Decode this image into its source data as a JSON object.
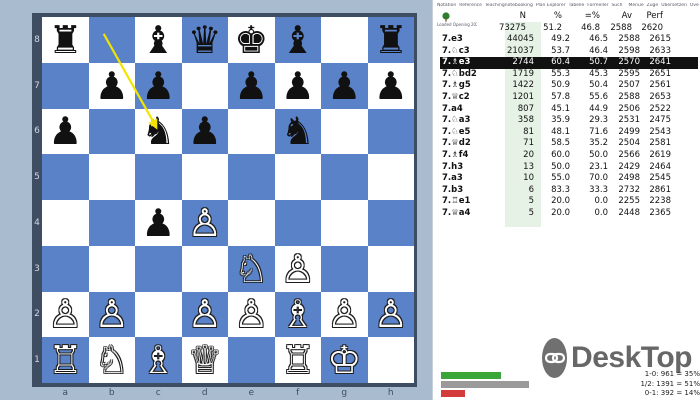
{
  "menu": [
    "Notation",
    "Reference",
    "Teachingnotebooking",
    "Plan Explorer",
    "Tabelle",
    "Formeller",
    "Such",
    "",
    "Menue",
    "Züge",
    "Übersetzen",
    "Overlaufi"
  ],
  "tree_caption": "Loaded Opening 2021",
  "board": {
    "ranks": [
      "8",
      "7",
      "6",
      "5",
      "4",
      "3",
      "2",
      "1"
    ],
    "files": [
      "a",
      "b",
      "c",
      "d",
      "e",
      "f",
      "g",
      "h"
    ],
    "squares": [
      [
        "♜",
        "",
        "♝",
        "♛",
        "♚",
        "♝",
        "",
        "♜"
      ],
      [
        "",
        "♟",
        "♟",
        "",
        "♟",
        "♟",
        "♟",
        "♟"
      ],
      [
        "♟",
        "",
        "♞",
        "♟",
        "",
        "♞",
        "",
        ""
      ],
      [
        "",
        "",
        "",
        "",
        "",
        "",
        "",
        ""
      ],
      [
        "",
        "",
        "♟",
        "♙",
        "",
        "",
        "",
        ""
      ],
      [
        "",
        "",
        "",
        "",
        "♘",
        "♙",
        "",
        ""
      ],
      [
        "♙",
        "♙",
        "",
        "♙",
        "♙",
        "♗",
        "♙",
        "♙"
      ],
      [
        "♖",
        "♘",
        "♗",
        "♕",
        "",
        "♖",
        "♔",
        ""
      ]
    ],
    "colors": [
      "b",
      "",
      "b",
      "b",
      "b",
      "b",
      "",
      "b",
      "",
      "b",
      "b",
      "",
      "b",
      "b",
      "b",
      "b",
      "b",
      "",
      "b",
      "b",
      "",
      "b",
      "",
      "",
      "",
      "",
      "",
      "",
      "",
      "",
      "",
      "",
      "",
      "",
      "b",
      "w",
      "",
      "",
      "",
      "",
      "",
      "",
      "",
      "",
      "w",
      "w",
      "",
      "",
      "w",
      "w",
      "",
      "w",
      "w",
      "w",
      "w",
      "w",
      "w",
      "w",
      "w",
      "w",
      "",
      "w",
      "w",
      ""
    ],
    "arrow": {
      "from": "b8",
      "to": "c6",
      "color": "#f2e400"
    },
    "light_color": "#ffffff",
    "dark_color": "#5a82c9"
  },
  "table": {
    "headers": {
      "n": "N",
      "pct": "%",
      "draw": "=%",
      "av": "Av",
      "perf": "Perf"
    },
    "totals": {
      "n": "73275",
      "pct": "51.2",
      "draw": "46.8",
      "av": "2588",
      "perf": "2620"
    },
    "rows": [
      {
        "move": "7.e3",
        "n": "44045",
        "pct": "49.2",
        "draw": "46.5",
        "av": "2588",
        "perf": "2615"
      },
      {
        "move": "7.♘c3",
        "n": "21037",
        "pct": "53.7",
        "draw": "46.4",
        "av": "2598",
        "perf": "2633"
      },
      {
        "move": "7.♗e3",
        "n": "2744",
        "pct": "60.4",
        "draw": "50.7",
        "av": "2570",
        "perf": "2641",
        "selected": true
      },
      {
        "move": "7.♘bd2",
        "n": "1719",
        "pct": "55.3",
        "draw": "45.3",
        "av": "2595",
        "perf": "2651"
      },
      {
        "move": "7.♗g5",
        "n": "1422",
        "pct": "50.9",
        "draw": "50.4",
        "av": "2507",
        "perf": "2561"
      },
      {
        "move": "7.♕c2",
        "n": "1201",
        "pct": "57.8",
        "draw": "55.6",
        "av": "2588",
        "perf": "2653"
      },
      {
        "move": "7.a4",
        "n": "807",
        "pct": "45.1",
        "draw": "44.9",
        "av": "2506",
        "perf": "2522"
      },
      {
        "move": "7.♘a3",
        "n": "358",
        "pct": "35.9",
        "draw": "29.3",
        "av": "2531",
        "perf": "2475"
      },
      {
        "move": "7.♘e5",
        "n": "81",
        "pct": "48.1",
        "draw": "71.6",
        "av": "2499",
        "perf": "2543"
      },
      {
        "move": "7.♕d2",
        "n": "71",
        "pct": "58.5",
        "draw": "35.2",
        "av": "2504",
        "perf": "2581"
      },
      {
        "move": "7.♗f4",
        "n": "20",
        "pct": "60.0",
        "draw": "50.0",
        "av": "2566",
        "perf": "2619"
      },
      {
        "move": "7.h3",
        "n": "13",
        "pct": "50.0",
        "draw": "23.1",
        "av": "2429",
        "perf": "2464"
      },
      {
        "move": "7.a3",
        "n": "10",
        "pct": "55.0",
        "draw": "70.0",
        "av": "2498",
        "perf": "2545"
      },
      {
        "move": "7.b3",
        "n": "6",
        "pct": "83.3",
        "draw": "33.3",
        "av": "2732",
        "perf": "2861"
      },
      {
        "move": "7.♖e1",
        "n": "5",
        "pct": "20.0",
        "draw": "0.0",
        "av": "2255",
        "perf": "2238"
      },
      {
        "move": "7.♕a4",
        "n": "5",
        "pct": "20.0",
        "draw": "0.0",
        "av": "2448",
        "perf": "2365"
      }
    ]
  },
  "result_stats": {
    "bars": [
      {
        "label": "1-0",
        "fraction": 0.35,
        "color": "#3aa63a"
      },
      {
        "label": "1/2",
        "fraction": 0.51,
        "color": "#9a9a9a"
      },
      {
        "label": "0-1",
        "fraction": 0.14,
        "color": "#d43c3c"
      }
    ],
    "lines": [
      "1-0: 961 = 35%",
      "1/2: 1391 = 51%",
      "0-1: 392 = 14%"
    ]
  },
  "watermark": {
    "text": "DeskTop",
    "icon": "link-chain-icon"
  }
}
